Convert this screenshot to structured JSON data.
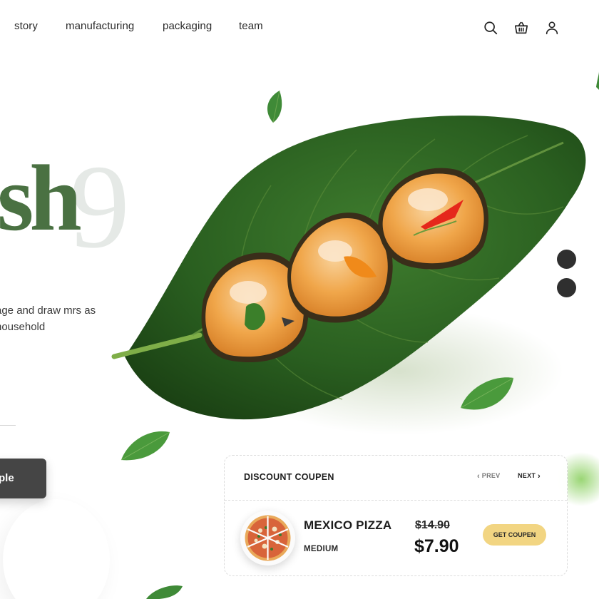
{
  "nav": {
    "links": [
      "story",
      "manufacturing",
      "packaging",
      "team"
    ],
    "icons": [
      "search-icon",
      "basket-icon",
      "user-icon"
    ]
  },
  "hero": {
    "word": "sh",
    "number": "9",
    "description": "age and draw mrs as household",
    "button_label": "ple"
  },
  "slider": {
    "dots": 2
  },
  "coupon": {
    "title": "DISCOUNT COUPEN",
    "prev_label": "PREV",
    "next_label": "NEXT",
    "product_name": "MEXICO PIZZA",
    "product_size": "MEDIUM",
    "old_price": "$14.90",
    "new_price": "$7.90",
    "button_label": "GET COUPEN"
  },
  "colors": {
    "brand_green": "#4a7142",
    "leaf_green": "#2f6a24",
    "accent_yellow": "#f2d582",
    "dark_button": "#454545"
  }
}
